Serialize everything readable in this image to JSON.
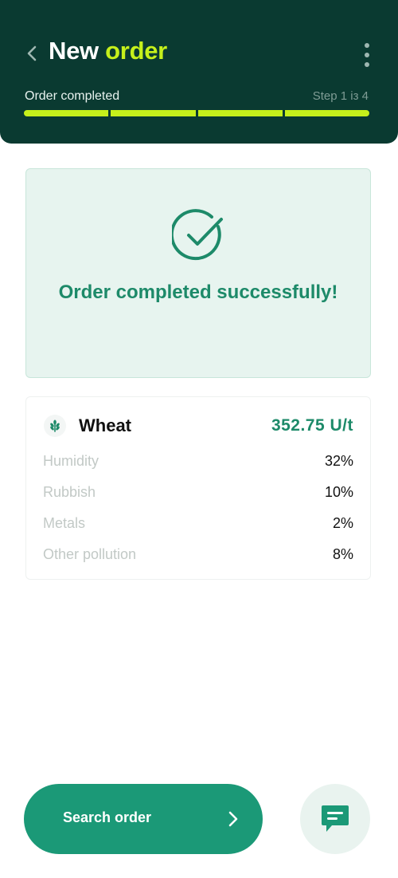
{
  "header": {
    "title_part1": "New",
    "title_part2": "order",
    "step_label": "Order completed",
    "step_count": "Step 1 із 4",
    "progress_segments_total": 4,
    "progress_segments_filled": 4,
    "accent_color": "#c6f01b",
    "background_color": "#0a3a31"
  },
  "success": {
    "message": "Order completed successfully!",
    "icon": "check-circle-icon"
  },
  "crop": {
    "icon": "wheat-icon",
    "name": "Wheat",
    "price": "352.75 U/t",
    "rows": [
      {
        "label": "Humidity",
        "value": "32%"
      },
      {
        "label": "Rubbish",
        "value": "10%"
      },
      {
        "label": "Metals",
        "value": "2%"
      },
      {
        "label": "Other pollution",
        "value": "8%"
      }
    ]
  },
  "actions": {
    "search_label": "Search order",
    "search_icon": "chevron-right-icon",
    "chat_icon": "chat-bubble-icon",
    "primary_color": "#1b9977"
  }
}
